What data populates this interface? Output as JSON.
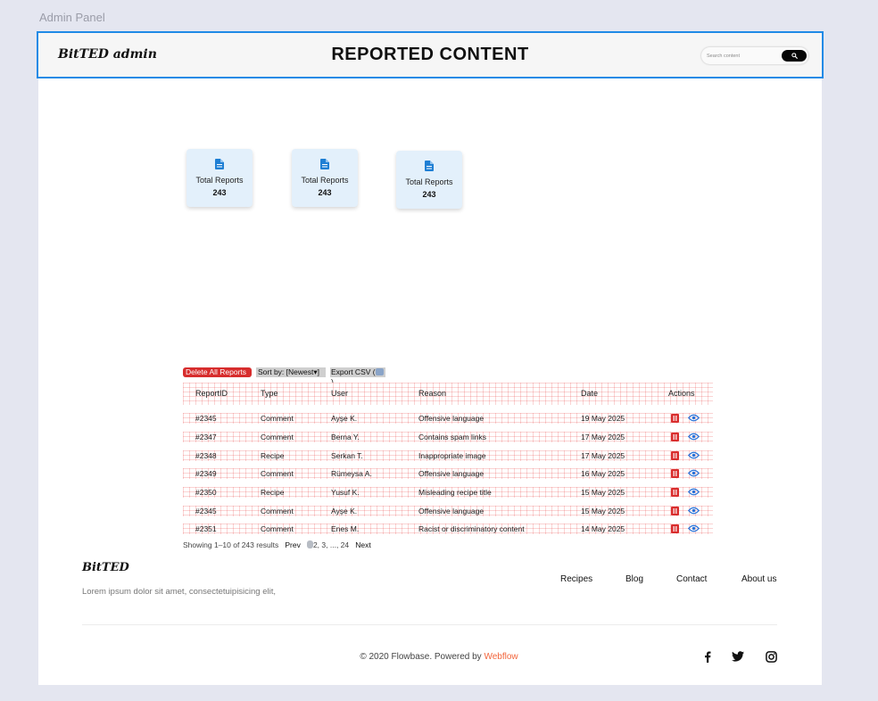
{
  "admin_label": "Admin Panel",
  "header": {
    "brand": "BitTED admin",
    "title": "REPORTED CONTENT",
    "search_placeholder": "Search content",
    "search_icon": "search-icon"
  },
  "stats": [
    {
      "icon": "document-icon",
      "label": "Total Reports",
      "value": "243"
    },
    {
      "icon": "document-icon",
      "label": "Total Reports",
      "value": "243"
    },
    {
      "icon": "document-icon",
      "label": "Total Reports",
      "value": "243"
    }
  ],
  "toolbar": {
    "delete_all": "Delete All Reports",
    "sort": "Sort by: [Newest",
    "export": "Export CSV ("
  },
  "table": {
    "headers": [
      "ReportID",
      "Type",
      "User",
      "Reason",
      "Date",
      "Actions"
    ],
    "rows": [
      [
        "#2345",
        "Comment",
        "Ayşe K.",
        "Offensive language",
        "19 May 2025"
      ],
      [
        "#2347",
        "Comment",
        "Berna Y.",
        "Contains spam links",
        "17 May 2025"
      ],
      [
        "#2348",
        "Recipe",
        "Serkan T.",
        "Inappropriate image",
        "17 May 2025"
      ],
      [
        "#2349",
        "Comment",
        "Rümeysa A.",
        "Offensive language",
        "16 May 2025"
      ],
      [
        "#2350",
        "Recipe",
        "Yusuf K.",
        "Misleading recipe title",
        "15 May 2025"
      ],
      [
        "#2345",
        "Comment",
        "Ayşe K.",
        "Offensive language",
        "15 May 2025"
      ],
      [
        "#2351",
        "Comment",
        "Enes M.",
        "Racist or discriminatory content",
        "14 May 2025"
      ]
    ],
    "action_icons": [
      "trash-icon",
      "eye-icon"
    ]
  },
  "pagination": {
    "showing": "Showing 1–10 of 243 results",
    "prev": "Prev",
    "pages": "2, 3, ..., 24",
    "next": "Next"
  },
  "footer": {
    "brand": "BitTED",
    "tagline": "Lorem ipsum dolor sit amet, consectetuipisicing elit,",
    "links": [
      "Recipes",
      "Blog",
      "Contact",
      "About us"
    ],
    "copyright_prefix": "© 2020 Flowbase. Powered by ",
    "copyright_link": "Webflow",
    "social_icons": [
      "facebook-icon",
      "twitter-icon",
      "instagram-icon"
    ]
  },
  "colors": {
    "header_border": "#1f8ae6",
    "stat_card_bg": "#e3f0fb",
    "icon_blue": "#1f7fd4",
    "danger": "#d72d2d",
    "webflow_link": "#f2643a"
  }
}
